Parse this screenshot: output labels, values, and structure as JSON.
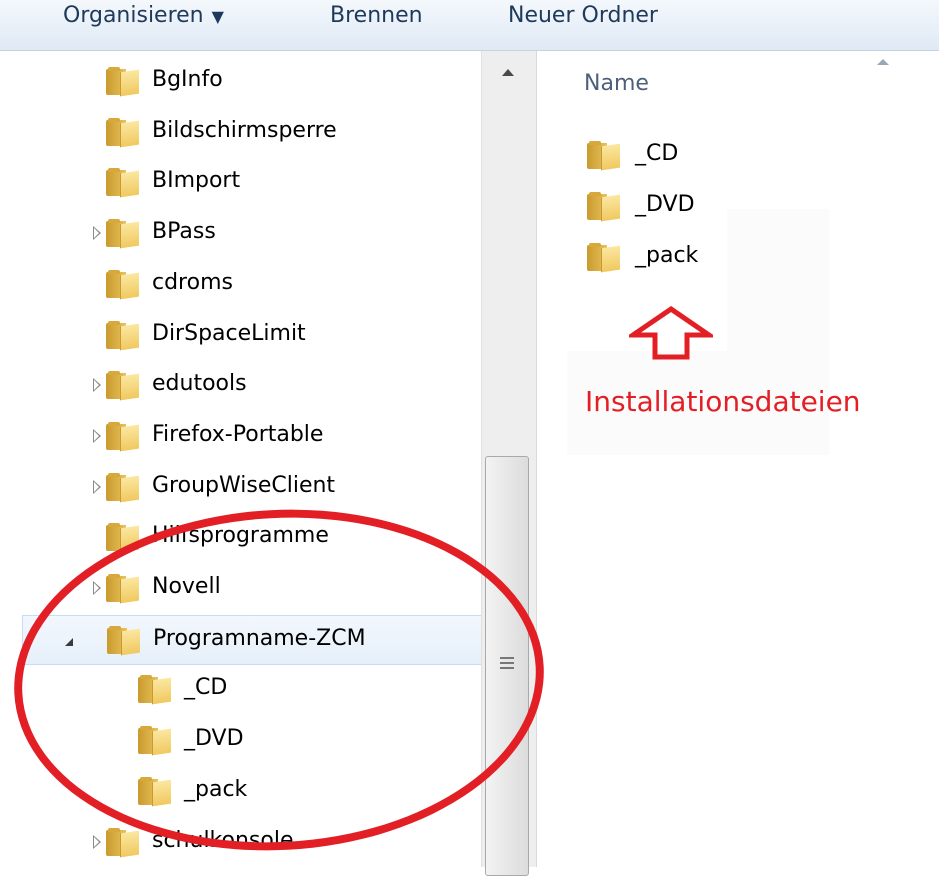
{
  "toolbar": {
    "organise_label": "Organisieren",
    "organise_caret": "▼",
    "burn_label": "Brennen",
    "new_folder_label": "Neuer Ordner"
  },
  "nav_tree": {
    "items": [
      {
        "label": "BgInfo",
        "expander": "none"
      },
      {
        "label": "Bildschirmsperre",
        "expander": "none"
      },
      {
        "label": "BImport",
        "expander": "none"
      },
      {
        "label": "BPass",
        "expander": "collapsed"
      },
      {
        "label": "cdroms",
        "expander": "none"
      },
      {
        "label": "DirSpaceLimit",
        "expander": "none"
      },
      {
        "label": "edutools",
        "expander": "collapsed"
      },
      {
        "label": "Firefox-Portable",
        "expander": "collapsed"
      },
      {
        "label": "GroupWiseClient",
        "expander": "collapsed"
      },
      {
        "label": "Hilfsprogramme",
        "expander": "none"
      },
      {
        "label": "Novell",
        "expander": "collapsed"
      },
      {
        "label": "Programname-ZCM",
        "expander": "expanded",
        "selected": true
      },
      {
        "label": "_CD",
        "expander": "none",
        "child": true
      },
      {
        "label": "_DVD",
        "expander": "none",
        "child": true
      },
      {
        "label": "_pack",
        "expander": "none",
        "child": true
      },
      {
        "label": "schulkonsole",
        "expander": "collapsed"
      }
    ]
  },
  "content": {
    "column_header": "Name",
    "files": [
      {
        "label": "_CD"
      },
      {
        "label": "_DVD"
      },
      {
        "label": "_pack"
      }
    ],
    "annotation": "Installationsdateien"
  },
  "colors": {
    "annotation_red": "#e31f26",
    "toolbar_text": "#1e395b",
    "header_text": "#4c607a"
  },
  "icons": {
    "folder": "folder-icon",
    "arrow": "up-arrow-outline",
    "expander_collapsed": "triangle-right-icon",
    "expander_expanded": "triangle-down-right-icon"
  }
}
